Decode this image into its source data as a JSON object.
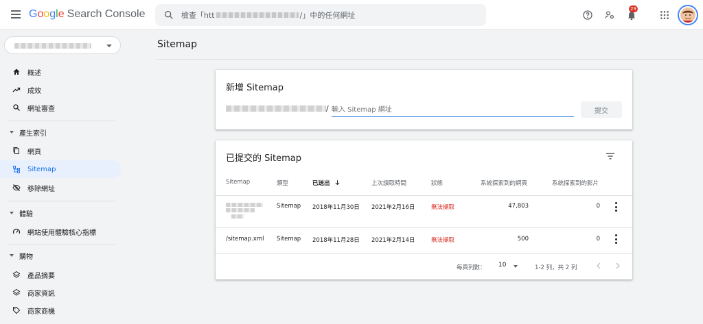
{
  "app": {
    "logo_google": [
      "G",
      "o",
      "o",
      "g",
      "l",
      "e"
    ],
    "logo_product": "Search Console"
  },
  "search": {
    "placeholder": "檢查「htt",
    "placeholder_suffix": "/」中的任何網址"
  },
  "notifications": {
    "count": "29"
  },
  "sidebar": {
    "overview": "概述",
    "performance": "成效",
    "url_inspection": "網址審查",
    "section_index": "產生索引",
    "pages": "網頁",
    "sitemaps": "Sitemap",
    "removals": "移除網址",
    "section_experience": "體驗",
    "core_web_vitals": "網站使用體驗核心指標",
    "section_shopping": "購物",
    "product_snippets": "產品摘要",
    "merchant_listings": "商家資訊",
    "shopping_tab": "商家商機"
  },
  "main": {
    "page_title": "Sitemap",
    "add_card": {
      "title": "新增 Sitemap",
      "slash": "/",
      "input_placeholder": "輸入 Sitemap 網址",
      "submit_label": "提交"
    },
    "submitted_card": {
      "title": "已提交的 Sitemap",
      "columns": {
        "sitemap": "Sitemap",
        "type": "類型",
        "submitted": "已送出",
        "last_read": "上次讀取時間",
        "status": "狀態",
        "discovered_pages": "系統探索到的網頁",
        "discovered_videos": "系統探索到的影片"
      },
      "rows": [
        {
          "sitemap": "",
          "type": "Sitemap",
          "submitted": "2018年11月30日",
          "last_read": "2021年2月16日",
          "status": "無法擷取",
          "pages": "47,803",
          "videos": "0"
        },
        {
          "sitemap": "/sitemap.xml",
          "type": "Sitemap",
          "submitted": "2018年11月28日",
          "last_read": "2021年2月14日",
          "status": "無法擷取",
          "pages": "500",
          "videos": "0"
        }
      ],
      "footer": {
        "rows_per_page_label": "每頁列數：",
        "rows_per_page_value": "10",
        "range": "1-2 列，共 2 列"
      }
    }
  },
  "colors": {
    "accent": "#1a73e8",
    "error": "#d93025",
    "active_bg": "#e8f0fe"
  }
}
